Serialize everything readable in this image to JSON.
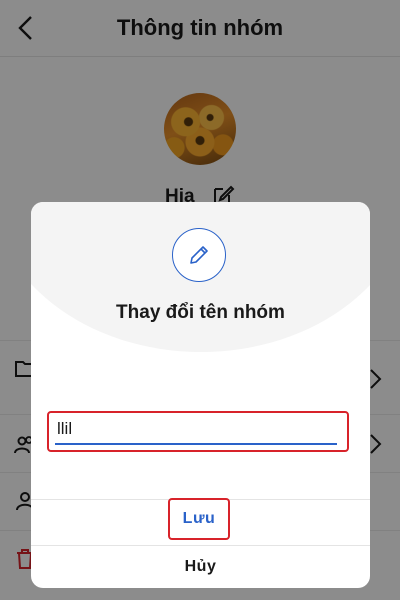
{
  "header": {
    "title": "Thông tin nhóm"
  },
  "group": {
    "name": "Hia"
  },
  "dialog": {
    "title": "Thay đổi tên nhóm",
    "input_value": "llil",
    "save_label": "Lưu",
    "cancel_label": "Hủy"
  },
  "colors": {
    "accent": "#2a62c9",
    "highlight": "#d8232a",
    "overlay": "rgba(0,0,0,0.45)"
  },
  "icons": [
    "back-arrow-icon",
    "edit-icon",
    "pencil-icon",
    "folder-icon",
    "group-icon",
    "user-icon",
    "trash-icon",
    "chevron-right-icon"
  ]
}
